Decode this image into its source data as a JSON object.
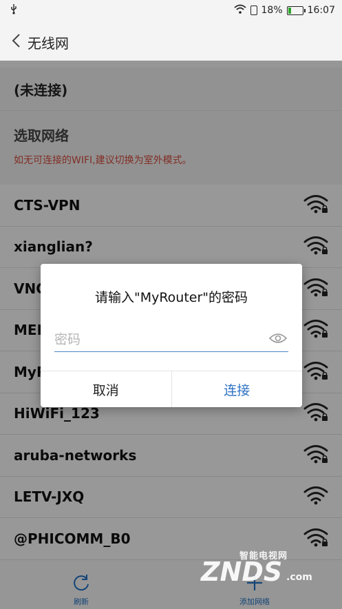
{
  "status_bar": {
    "battery": "18%",
    "time": "16:07",
    "battery_level": 0.18
  },
  "header": {
    "title": "无线网"
  },
  "connection_status": "(未连接)",
  "select_section": {
    "title": "选取网络",
    "hint": "如无可连接的WIFI,建议切换为室外模式。"
  },
  "networks": [
    {
      "name": "CTS-VPN",
      "locked": true
    },
    {
      "name": "xianglian?",
      "locked": true
    },
    {
      "name": "VNC",
      "locked": true
    },
    {
      "name": "MER",
      "locked": true
    },
    {
      "name": "MyR",
      "locked": true
    },
    {
      "name": "HiWiFi_123",
      "locked": true
    },
    {
      "name": "aruba-networks",
      "locked": true
    },
    {
      "name": "LETV-JXQ",
      "locked": false
    },
    {
      "name": "@PHICOMM_B0",
      "locked": true
    }
  ],
  "dialog": {
    "title": "请输入\"MyRouter\"的密码",
    "password_placeholder": "密码",
    "password_value": "",
    "cancel_label": "取消",
    "connect_label": "连接"
  },
  "bottom_bar": {
    "refresh_label": "刷新",
    "add_network_label": "添加网络"
  },
  "watermark": {
    "top": "智能电视网",
    "main": "ZNDS",
    "suffix": ".com"
  },
  "colors": {
    "accent": "#2f73c4",
    "hint": "#d04b3c",
    "battery": "#2aa52a"
  },
  "icons": {
    "back": "chevron-left-icon",
    "wifi": "wifi-icon",
    "lock": "lock-icon",
    "eye": "eye-icon",
    "refresh": "refresh-icon",
    "add": "plus-icon",
    "usb": "usb-icon"
  }
}
